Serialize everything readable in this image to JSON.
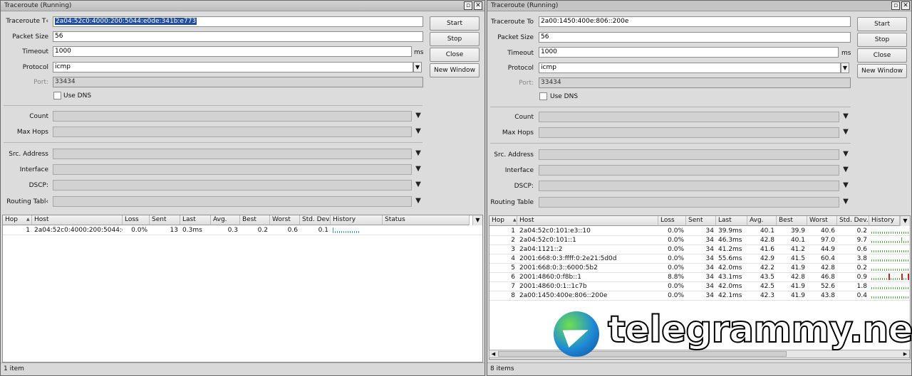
{
  "windows": [
    {
      "title": "Traceroute (Running)",
      "fields": {
        "traceroute_to": {
          "label": "Traceroute T‹",
          "value": "2a04:52c0:4000:200:5044:e0de:341b:e773"
        },
        "packet_size": {
          "label": "Packet Size",
          "value": "56"
        },
        "timeout": {
          "label": "Timeout",
          "value": "1000",
          "unit": "ms"
        },
        "protocol": {
          "label": "Protocol",
          "value": "icmp"
        },
        "port": {
          "label": "Port:",
          "value": "33434"
        },
        "use_dns": {
          "label": "Use DNS",
          "checked": false
        },
        "count": {
          "label": "Count"
        },
        "max_hops": {
          "label": "Max Hops"
        },
        "src_address": {
          "label": "Src. Address"
        },
        "interface": {
          "label": "Interface"
        },
        "dscp": {
          "label": "DSCP:"
        },
        "routing_table": {
          "label": "Routing Tabl‹"
        }
      },
      "buttons": {
        "start": "Start",
        "stop": "Stop",
        "close": "Close",
        "new_window": "New Window"
      },
      "columns": [
        "Hop",
        "Host",
        "Loss",
        "Sent",
        "Last",
        "Avg.",
        "Best",
        "Worst",
        "Std. Dev.",
        "History",
        "Status"
      ],
      "rows": [
        {
          "hop": "1",
          "host": "2a04:52c0:4000:200:5044:e...",
          "loss": "0.0%",
          "sent": "13",
          "last": "0.3ms",
          "avg": "0.3",
          "best": "0.2",
          "worst": "0.6",
          "std": "0.1",
          "history": [
            8,
            3,
            3,
            3,
            3,
            3,
            3,
            3,
            3,
            3,
            3,
            3,
            3
          ],
          "loss_bars": []
        }
      ],
      "status": "1 item"
    },
    {
      "title": "Traceroute (Running)",
      "fields": {
        "traceroute_to": {
          "label": "Traceroute To",
          "value": "2a00:1450:400e:806::200e"
        },
        "packet_size": {
          "label": "Packet Size",
          "value": "56"
        },
        "timeout": {
          "label": "Timeout",
          "value": "1000",
          "unit": "ms"
        },
        "protocol": {
          "label": "Protocol",
          "value": "icmp"
        },
        "port": {
          "label": "Port:",
          "value": "33434"
        },
        "use_dns": {
          "label": "Use DNS",
          "checked": false
        },
        "count": {
          "label": "Count"
        },
        "max_hops": {
          "label": "Max Hops"
        },
        "src_address": {
          "label": "Src. Address"
        },
        "interface": {
          "label": "Interface"
        },
        "dscp": {
          "label": "DSCP:"
        },
        "routing_table": {
          "label": "Routing Table"
        }
      },
      "buttons": {
        "start": "Start",
        "stop": "Stop",
        "close": "Close",
        "new_window": "New Window"
      },
      "columns": [
        "Hop",
        "Host",
        "Loss",
        "Sent",
        "Last",
        "Avg.",
        "Best",
        "Worst",
        "Std. Dev.",
        "History"
      ],
      "rows": [
        {
          "hop": "1",
          "host": "2a04:52c0:101:e3::10",
          "loss": "0.0%",
          "sent": "34",
          "last": "39.9ms",
          "avg": "40.1",
          "best": "39.9",
          "worst": "40.6",
          "std": "0.2",
          "history": [
            3,
            3,
            3,
            3,
            3,
            3,
            3,
            3,
            3,
            3,
            3,
            3,
            3,
            3,
            3,
            3,
            3,
            3,
            3,
            3
          ],
          "loss_bars": []
        },
        {
          "hop": "2",
          "host": "2a04:52c0:101::1",
          "loss": "0.0%",
          "sent": "34",
          "last": "46.3ms",
          "avg": "42.8",
          "best": "40.1",
          "worst": "97.0",
          "std": "9.7",
          "history": [
            3,
            3,
            3,
            3,
            3,
            3,
            3,
            3,
            3,
            3,
            3,
            3,
            3,
            3,
            8,
            3,
            3,
            3,
            3,
            3
          ],
          "loss_bars": []
        },
        {
          "hop": "3",
          "host": "2a04:1121::2",
          "loss": "0.0%",
          "sent": "34",
          "last": "41.2ms",
          "avg": "41.6",
          "best": "41.2",
          "worst": "44.9",
          "std": "0.6",
          "history": [
            3,
            3,
            3,
            3,
            3,
            3,
            3,
            3,
            3,
            3,
            3,
            3,
            3,
            3,
            3,
            3,
            3,
            3,
            3,
            3
          ],
          "loss_bars": []
        },
        {
          "hop": "4",
          "host": "2001:668:0:3:ffff:0:2e21:5d0d",
          "loss": "0.0%",
          "sent": "34",
          "last": "55.6ms",
          "avg": "42.9",
          "best": "41.5",
          "worst": "60.4",
          "std": "3.8",
          "history": [
            3,
            3,
            3,
            3,
            3,
            3,
            3,
            3,
            3,
            3,
            3,
            3,
            3,
            3,
            3,
            3,
            3,
            3,
            3,
            3
          ],
          "loss_bars": []
        },
        {
          "hop": "5",
          "host": "2001:668:0:3::6000:5b2",
          "loss": "0.0%",
          "sent": "34",
          "last": "42.0ms",
          "avg": "42.2",
          "best": "41.9",
          "worst": "42.8",
          "std": "0.2",
          "history": [
            3,
            3,
            3,
            3,
            3,
            3,
            3,
            3,
            3,
            3,
            3,
            3,
            3,
            3,
            3,
            3,
            3,
            3,
            3,
            3
          ],
          "loss_bars": []
        },
        {
          "hop": "6",
          "host": "2001:4860:0:f8b::1",
          "loss": "8.8%",
          "sent": "34",
          "last": "43.1ms",
          "avg": "43.5",
          "best": "42.8",
          "worst": "46.8",
          "std": "0.9",
          "history": [
            3,
            3,
            3,
            3,
            3,
            3,
            3,
            3,
            9,
            3,
            3,
            3,
            3,
            3,
            9,
            3,
            3,
            9,
            3,
            3
          ],
          "loss_bars": [
            8,
            14,
            17
          ]
        },
        {
          "hop": "7",
          "host": "2001:4860:0:1::1c7b",
          "loss": "0.0%",
          "sent": "34",
          "last": "42.0ms",
          "avg": "42.5",
          "best": "41.9",
          "worst": "52.6",
          "std": "1.8",
          "history": [
            3,
            3,
            3,
            3,
            3,
            3,
            3,
            3,
            3,
            3,
            3,
            3,
            3,
            3,
            3,
            3,
            3,
            3,
            3,
            3
          ],
          "loss_bars": []
        },
        {
          "hop": "8",
          "host": "2a00:1450:400e:806::200e",
          "loss": "0.0%",
          "sent": "34",
          "last": "42.1ms",
          "avg": "42.3",
          "best": "41.9",
          "worst": "43.8",
          "std": "0.4",
          "history": [
            3,
            3,
            3,
            3,
            3,
            3,
            3,
            3,
            3,
            3,
            3,
            3,
            3,
            3,
            3,
            3,
            3,
            3,
            3,
            3
          ],
          "loss_bars": []
        }
      ],
      "status": "8 items"
    }
  ],
  "watermark": "telegrammy.net",
  "colors": {
    "selection": "#1f4ea0",
    "history_ok": "#5aa84a",
    "history_hop1": "#3fa0b0",
    "history_loss": "#cc2222"
  },
  "icons": {
    "maximize": "maximize-icon",
    "close": "close-icon",
    "dropdown": "dropdown-arrow-icon",
    "sort": "sort-asc-icon"
  }
}
